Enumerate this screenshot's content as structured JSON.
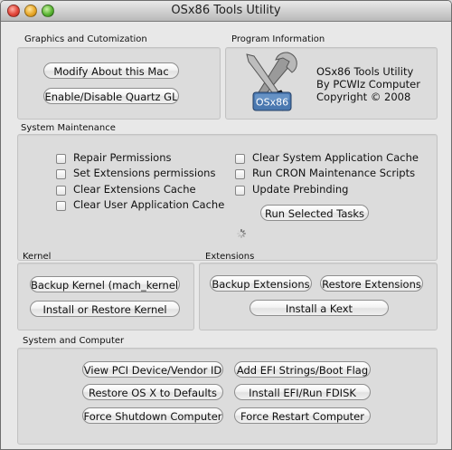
{
  "window": {
    "title": "OSx86 Tools Utility"
  },
  "graphics": {
    "label": "Graphics and Cutomization",
    "buttons": [
      "Modify About this Mac",
      "Enable/Disable Quartz GL"
    ]
  },
  "program_info": {
    "label": "Program Information",
    "logo_text": "OSx86",
    "lines": [
      "OSx86 Tools Utility",
      "By PCWIz Computer",
      "Copyright © 2008"
    ]
  },
  "maintenance": {
    "label": "System Maintenance",
    "left_options": [
      "Repair Permissions",
      "Set Extensions permissions",
      "Clear Extensions Cache",
      "Clear User Application Cache"
    ],
    "right_options": [
      "Clear System Application Cache",
      "Run CRON Maintenance Scripts",
      "Update Prebinding"
    ],
    "run_button": "Run Selected Tasks"
  },
  "kernel": {
    "label": "Kernel",
    "buttons": [
      "Backup Kernel (mach_kernel)",
      "Install or Restore Kernel"
    ]
  },
  "extensions": {
    "label": "Extensions",
    "buttons": [
      "Backup Extensions",
      "Restore Extensions",
      "Install a Kext"
    ]
  },
  "system": {
    "label": "System and Computer",
    "buttons": [
      "View PCI Device/Vendor ID",
      "Add EFI Strings/Boot Flag",
      "Restore OS X to Defaults",
      "Install EFI/Run FDISK",
      "Force Shutdown Computer",
      "Force Restart Computer"
    ]
  }
}
